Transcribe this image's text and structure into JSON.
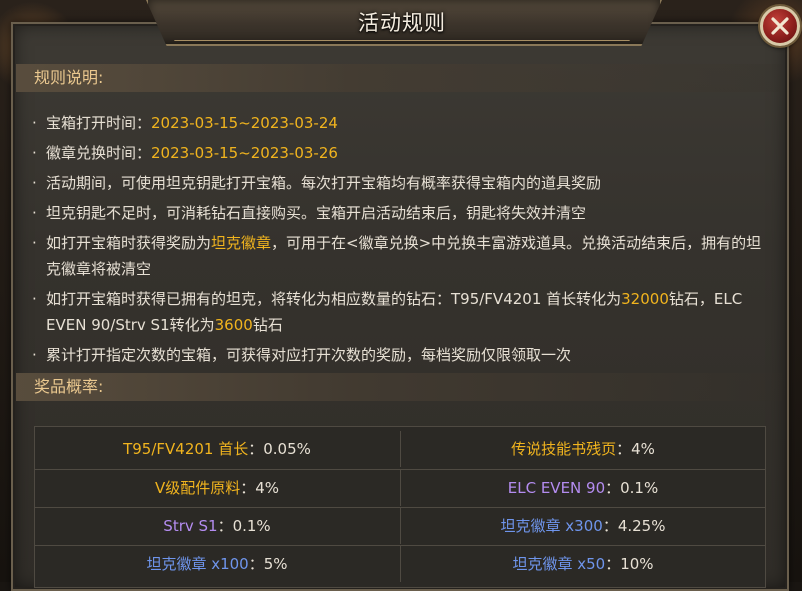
{
  "header": {
    "title": "活动规则"
  },
  "rules_section": {
    "label": "规则说明:"
  },
  "rules": [
    {
      "segments": [
        {
          "text": "宝箱打开时间："
        },
        {
          "text": "2023-03-15~2023-03-24",
          "hl": true
        }
      ]
    },
    {
      "segments": [
        {
          "text": "徽章兑换时间："
        },
        {
          "text": "2023-03-15~2023-03-26",
          "hl": true
        }
      ]
    },
    {
      "segments": [
        {
          "text": "活动期间，可使用坦克钥匙打开宝箱。每次打开宝箱均有概率获得宝箱内的道具奖励"
        }
      ]
    },
    {
      "segments": [
        {
          "text": "坦克钥匙不足时，可消耗钻石直接购买。宝箱开启活动结束后，钥匙将失效并清空"
        }
      ]
    },
    {
      "segments": [
        {
          "text": "如打开宝箱时获得奖励为"
        },
        {
          "text": "坦克徽章",
          "hl": true
        },
        {
          "text": "，可用于在<徽章兑换>中兑换丰富游戏道具。兑换活动结束后，拥有的坦克徽章将被清空"
        }
      ]
    },
    {
      "segments": [
        {
          "text": "如打开宝箱时获得已拥有的坦克，将转化为相应数量的钻石：T95/FV4201 首长转化为"
        },
        {
          "text": "32000",
          "hl": true
        },
        {
          "text": "钻石，ELC EVEN 90/Strv S1转化为"
        },
        {
          "text": "3600",
          "hl": true
        },
        {
          "text": "钻石"
        }
      ]
    },
    {
      "segments": [
        {
          "text": "累计打开指定次数的宝箱，可获得对应打开次数的奖励，每档奖励仅限领取一次"
        }
      ]
    }
  ],
  "prize_section": {
    "label": "奖品概率:"
  },
  "prize_rows": [
    [
      {
        "name": "T95/FV4201 首长",
        "rate": "：0.05%",
        "color": "#f1b41e"
      },
      {
        "name": "传说技能书残页",
        "rate": "：4%",
        "color": "#f1b41e"
      }
    ],
    [
      {
        "name": "V级配件原料",
        "rate": "：4%",
        "color": "#f1b41e"
      },
      {
        "name": "ELC EVEN 90",
        "rate": "：0.1%",
        "color": "#b48cf0"
      }
    ],
    [
      {
        "name": "Strv S1",
        "rate": "：0.1%",
        "color": "#b48cf0"
      },
      {
        "name": "坦克徽章 x300",
        "rate": "：4.25%",
        "color": "#6f95ec"
      }
    ],
    [
      {
        "name": "坦克徽章 x100",
        "rate": "：5%",
        "color": "#6f95ec"
      },
      {
        "name": "坦克徽章 x50",
        "rate": "：10%",
        "color": "#6f95ec"
      }
    ]
  ],
  "colors": {
    "highlight": "#f1b41e",
    "section_label": "#eac88f",
    "close_button": "#a8302b"
  },
  "icons": {
    "close": "close-x-icon"
  }
}
